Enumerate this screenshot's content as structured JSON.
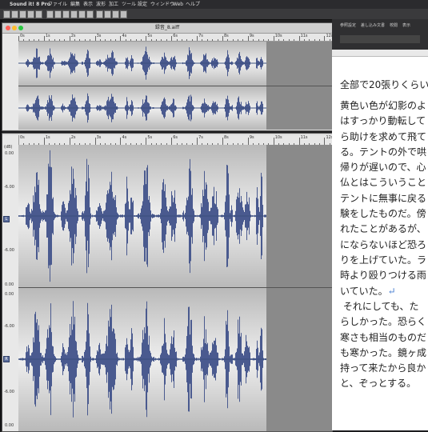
{
  "menubar": {
    "app_name": "Sound it! 8 Pro",
    "items": [
      "ファイル",
      "編集",
      "表示",
      "波形",
      "加工",
      "ツール",
      "設定",
      "ウィンドウ",
      "Web",
      "ヘルプ"
    ]
  },
  "overview_window": {
    "title": "録音_8.aiff"
  },
  "ruler": {
    "top_ticks": [
      "0s",
      "1s",
      "2s",
      "3s",
      "4s",
      "5s",
      "6s",
      "7s",
      "8s",
      "9s",
      "10s",
      "11s",
      "12s"
    ],
    "bottom_ticks": [
      "0s",
      "1s",
      "2s",
      "3s",
      "4s",
      "5s",
      "6s",
      "7s",
      "8s",
      "9s",
      "10s",
      "11s",
      "12s"
    ]
  },
  "editor": {
    "corner_label": "(dB)",
    "channel_left_label": "L",
    "channel_right_label": "R",
    "db_top": [
      "0.00",
      "-6.00",
      "-6.00",
      "0.00"
    ],
    "db_bottom": [
      "0.00",
      "-6.00",
      "-6.00",
      "0.00"
    ]
  },
  "document": {
    "toolbar": [
      "参照設定",
      "差し込み文書",
      "校閲",
      "表示"
    ],
    "heading": "全部で20張りくらい",
    "paragraph1": [
      "黄色い色が幻影のよ",
      "はすっかり動転して",
      "ら助けを求めて飛て",
      "る。テントの外で哄",
      "帰りが遅いので、心",
      "仏とはこういうこと",
      "テントに無事に戻る",
      "験をしたものだ。傍",
      "れたことがあるが、",
      "にならないほど恐ろ",
      "りを上げていた。ラ",
      "時より殴りつける雨",
      "いていた。"
    ],
    "paragraph2": [
      " それにしても、た",
      "らしかった。恐らく",
      "寒さも相当のものだ",
      "も寒かった。鏡ヶ成",
      "持って来たから良か",
      "と、ぞっとする。"
    ],
    "return_mark": "↵"
  },
  "colors": {
    "waveform": "#4a5a8f",
    "accent": "#3a4f7e"
  }
}
